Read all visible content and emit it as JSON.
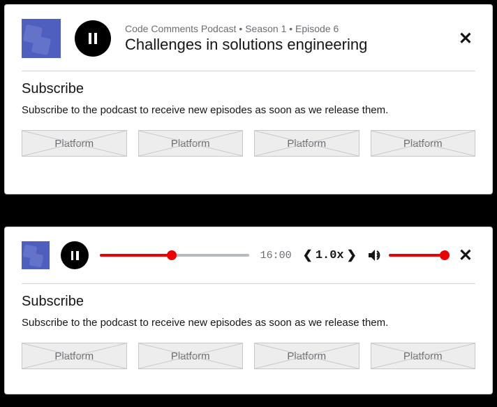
{
  "card1": {
    "meta": "Code Comments Podcast • Season 1 • Episode 6",
    "title": "Challenges in solutions engineering"
  },
  "subscribe": {
    "heading": "Subscribe",
    "text": "Subscribe to the podcast to receive new episodes as soon as we release them.",
    "platforms": [
      "Platform",
      "Platform",
      "Platform",
      "Platform"
    ]
  },
  "player": {
    "time": "16:00",
    "speed": "1.0x",
    "progress_percent": 48,
    "volume_percent": 100
  }
}
